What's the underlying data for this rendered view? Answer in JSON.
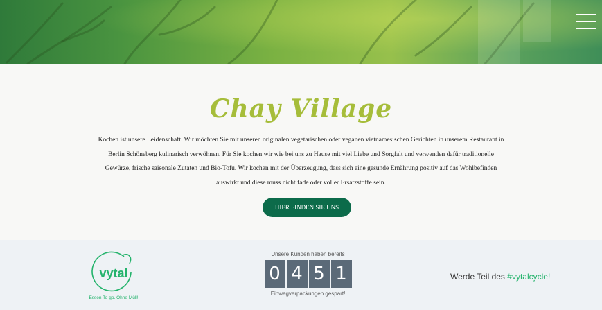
{
  "header": {
    "menu_icon": "hamburger-menu-icon"
  },
  "intro": {
    "title": "Chay Village",
    "description": "Kochen ist unsere Leidenschaft. Wir möchten Sie mit unseren originalen vegetarischen oder veganen vietnamesischen Gerichten in unserem Restaurant in Berlin Schöneberg kulinarisch verwöhnen. Für Sie kochen wir wie bei uns zu Hause mit viel Liebe und Sorgfalt und verwenden dafür traditionelle Gewürze, frische saisonale Zutaten und Bio-Tofu. Wir kochen mit der Überzeugung, dass sich eine gesunde Ernährung positiv auf das Wohlbefinden auswirkt und diese muss nicht fade oder voller Ersatzstoffe sein.",
    "cta_label": "HIER FINDEN SIE UNS",
    "title_color": "#a6bd3a",
    "cta_color": "#0c6b4a"
  },
  "vytal": {
    "logo_text": "vytal",
    "tagline": "Essen To-go. Ohne Müll!",
    "counter_label_top": "Unsere Kunden haben bereits",
    "digits": [
      "0",
      "4",
      "5",
      "1"
    ],
    "counter_label_bottom": "Einwegverpackungen gespart!",
    "join_text": "Werde Teil des ",
    "hashtag": "#vytalcycle!",
    "brand_color": "#23b36b"
  }
}
